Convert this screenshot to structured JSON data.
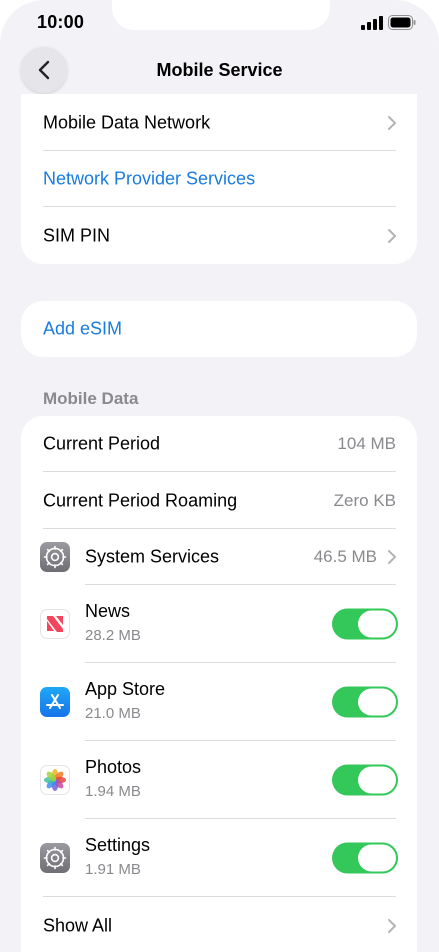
{
  "status_bar": {
    "time": "10:00"
  },
  "nav": {
    "back_icon": "chevron-left-icon",
    "title": "Mobile Service"
  },
  "group1": [
    {
      "label": "Mobile Data Network",
      "chevron": true
    },
    {
      "label": "Network Provider Services",
      "blue": true
    },
    {
      "label": "SIM PIN",
      "chevron": true
    }
  ],
  "esim": {
    "label": "Add eSIM"
  },
  "mobile_data": {
    "header": "Mobile Data",
    "current_period": {
      "label": "Current Period",
      "value": "104 MB"
    },
    "current_period_roaming": {
      "label": "Current Period Roaming",
      "value": "Zero KB"
    },
    "system_services": {
      "label": "System Services",
      "value": "46.5 MB",
      "icon": "gear-icon"
    },
    "apps": [
      {
        "name": "News",
        "usage": "28.2 MB",
        "icon": "news-icon",
        "enabled": true
      },
      {
        "name": "App Store",
        "usage": "21.0 MB",
        "icon": "app-store-icon",
        "enabled": true
      },
      {
        "name": "Photos",
        "usage": "1.94 MB",
        "icon": "photos-icon",
        "enabled": true
      },
      {
        "name": "Settings",
        "usage": "1.91 MB",
        "icon": "gear-icon",
        "enabled": true
      }
    ],
    "show_all": {
      "label": "Show All"
    }
  },
  "colors": {
    "accent_blue": "#1a7ce0",
    "toggle_on": "#34c759",
    "background": "#f2f2f7",
    "secondary_text": "#8a8a8e"
  }
}
